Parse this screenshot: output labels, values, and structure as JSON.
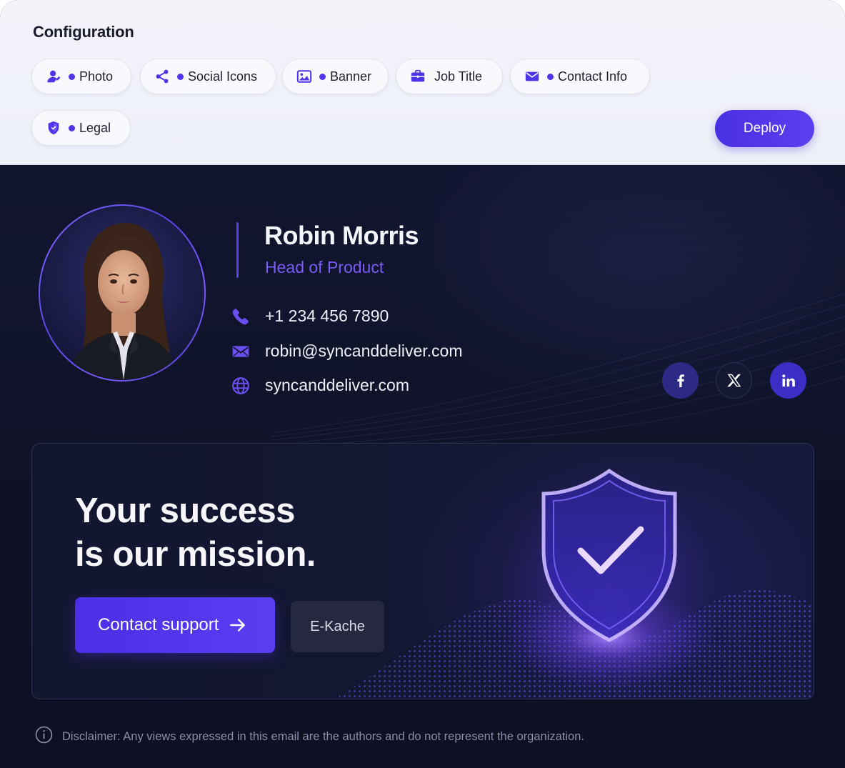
{
  "config": {
    "title": "Configuration",
    "chips": [
      {
        "label": "Photo",
        "icon": "user-icon",
        "active": true
      },
      {
        "label": "Social Icons",
        "icon": "share-icon",
        "active": true
      },
      {
        "label": "Banner",
        "icon": "image-icon",
        "active": true
      },
      {
        "label": "Job Title",
        "icon": "briefcase-icon",
        "active": false
      },
      {
        "label": "Contact Info",
        "icon": "envelope-icon",
        "active": true
      },
      {
        "label": "Legal",
        "icon": "shield-icon",
        "active": true
      }
    ],
    "deploy_label": "Deploy"
  },
  "signature": {
    "name": "Robin Morris",
    "title": "Head of Product",
    "phone": "+1 234 456 7890",
    "email": "robin@syncanddeliver.com",
    "website": "syncanddeliver.com",
    "social": [
      "facebook-icon",
      "x-icon",
      "linkedin-icon"
    ]
  },
  "banner": {
    "headline_line1": "Your success",
    "headline_line2": "is our mission.",
    "cta_label": "Contact support",
    "secondary_label": "E-Kache"
  },
  "disclaimer": "Disclaimer: Any views expressed in this email are the authors and do not represent the organization.",
  "colors": {
    "accent": "#4f35e8",
    "accent_text": "#7a5cf5",
    "dark_bg": "#0f1225",
    "panel_bg": "#f3f4fa"
  }
}
